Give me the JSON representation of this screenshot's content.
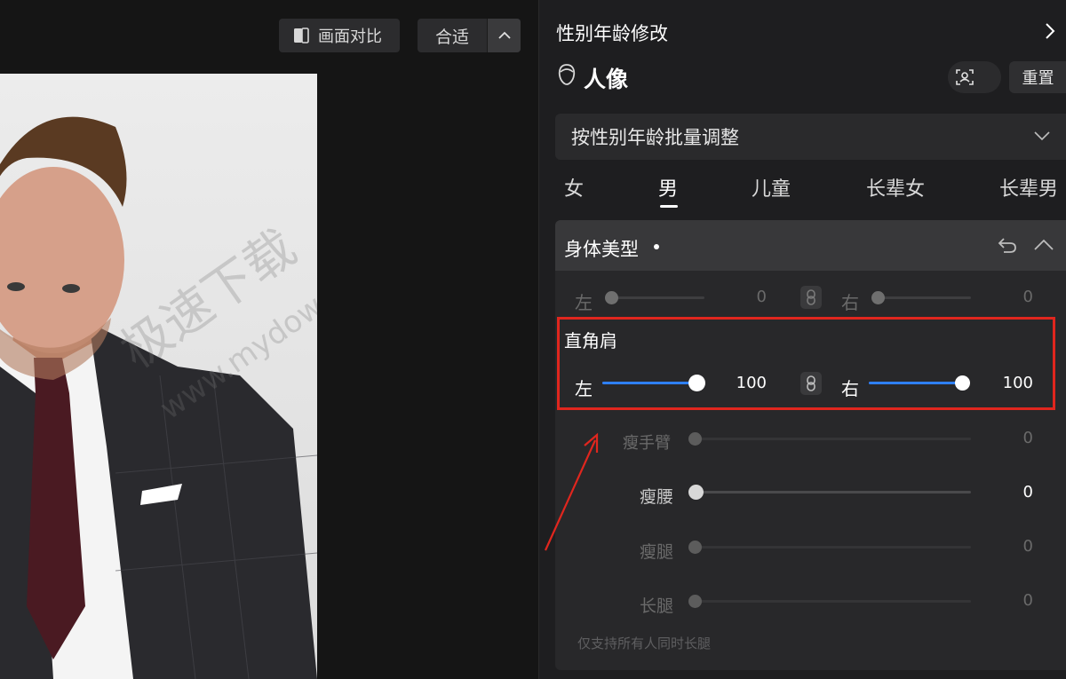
{
  "toolbar": {
    "compare_label": "画面对比",
    "fit_label": "合适"
  },
  "canvas": {
    "watermark_cn": "极速下载",
    "watermark_en": "www.mydow"
  },
  "panel": {
    "title": "性别年龄修改",
    "portrait_label": "人像",
    "reset_label": "重置",
    "batch_dropdown": "按性别年龄批量调整",
    "tabs": [
      "女",
      "男",
      "儿童",
      "长辈女",
      "长辈男"
    ],
    "active_tab": "男"
  },
  "section": {
    "title": "身体美型",
    "top_row": {
      "left_label": "左",
      "left_value": "0",
      "right_label": "右",
      "right_value": "0"
    },
    "shoulder": {
      "title": "直角肩",
      "left_label": "左",
      "left_value": "100",
      "right_label": "右",
      "right_value": "100"
    },
    "sliders": [
      {
        "label": "瘦手臂",
        "value": "0"
      },
      {
        "label": "瘦腰",
        "value": "0"
      },
      {
        "label": "瘦腿",
        "value": "0"
      },
      {
        "label": "长腿",
        "value": "0"
      }
    ],
    "note": "仅支持所有人同时长腿"
  },
  "colors": {
    "accent": "#2f80ff",
    "highlight": "#e0261e",
    "panel_bg": "#1e1e20"
  }
}
